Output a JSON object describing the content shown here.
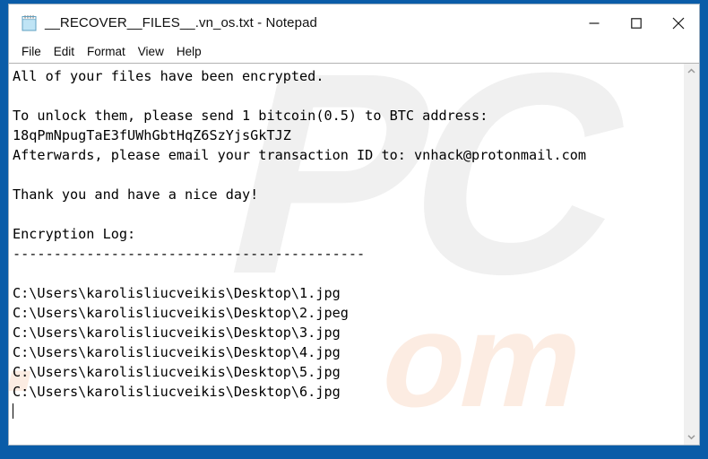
{
  "window": {
    "title": "__RECOVER__FILES__.vn_os.txt - Notepad",
    "icon": "notepad-icon",
    "frame_color": "#0a5ca8",
    "controls": {
      "minimize": "minimize-icon",
      "maximize": "maximize-icon",
      "close": "close-icon"
    }
  },
  "menu": {
    "items": [
      {
        "label": "File"
      },
      {
        "label": "Edit"
      },
      {
        "label": "Format"
      },
      {
        "label": "View"
      },
      {
        "label": "Help"
      }
    ]
  },
  "document": {
    "lines": [
      "All of your files have been encrypted.",
      "",
      "To unlock them, please send 1 bitcoin(0.5) to BTC address:",
      "18qPmNpugTaE3fUWhGbtHqZ6SzYjsGkTJZ",
      "Afterwards, please email your transaction ID to: vnhack@protonmail.com",
      "",
      "Thank you and have a nice day!",
      "",
      "Encryption Log:",
      "-------------------------------------------",
      "",
      "C:\\Users\\karolisliucveikis\\Desktop\\1.jpg",
      "C:\\Users\\karolisliucveikis\\Desktop\\2.jpeg",
      "C:\\Users\\karolisliucveikis\\Desktop\\3.jpg",
      "C:\\Users\\karolisliucveikis\\Desktop\\4.jpg",
      "C:\\Users\\karolisliucveikis\\Desktop\\5.jpg",
      "C:\\Users\\karolisliucveikis\\Desktop\\6.jpg"
    ],
    "bitcoin_address": "18qPmNpugTaE3fUWhGbtHqZ6SzYjsGkTJZ",
    "contact_email": "vnhack@protonmail.com",
    "ransom_amount": "1 bitcoin(0.5)",
    "caret_visible": true
  },
  "watermark": {
    "primary": "PC",
    "suffix": "om",
    "dot": ".",
    "primary_color": "#f0f0f0",
    "suffix_color": "#fcece2"
  },
  "scrollbar": {
    "up_arrow": "chevron-up-icon",
    "down_arrow": "chevron-down-icon"
  }
}
